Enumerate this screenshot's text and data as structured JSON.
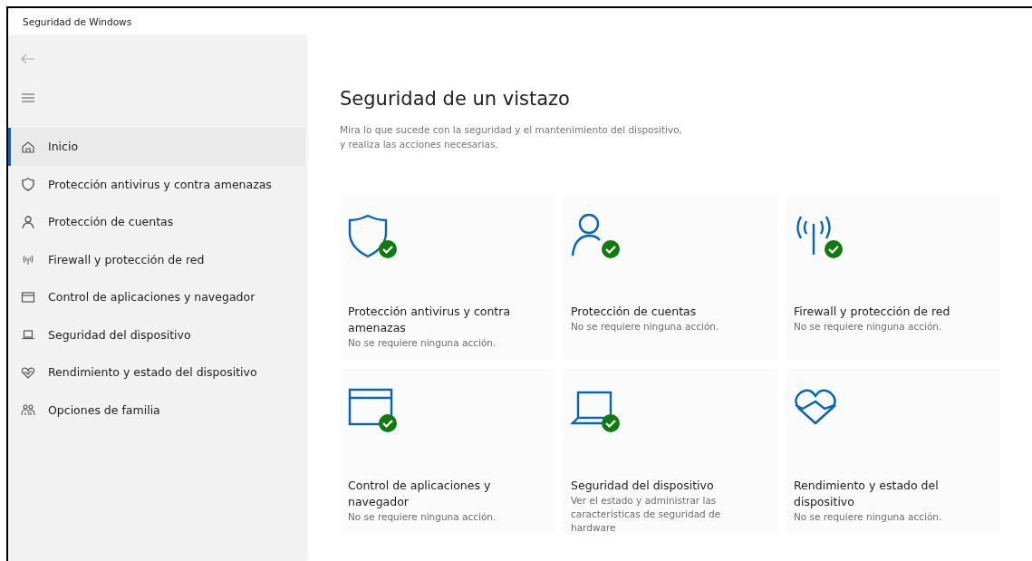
{
  "window": {
    "title": "Seguridad de Windows"
  },
  "sidebar": {
    "items": [
      {
        "label": "Inicio",
        "selected": true
      },
      {
        "label": "Protección antivirus y contra amenazas",
        "selected": false
      },
      {
        "label": "Protección de cuentas",
        "selected": false
      },
      {
        "label": "Firewall y protección de red",
        "selected": false
      },
      {
        "label": "Control de aplicaciones y navegador",
        "selected": false
      },
      {
        "label": "Seguridad del dispositivo",
        "selected": false
      },
      {
        "label": "Rendimiento y estado del dispositivo",
        "selected": false
      },
      {
        "label": "Opciones de familia",
        "selected": false
      }
    ]
  },
  "main": {
    "title": "Seguridad de un vistazo",
    "description": "Mira lo que sucede con la seguridad y el mantenimiento del dispositivo, y realiza las acciones necesarias.",
    "cards": [
      {
        "title": "Protección antivirus y contra amenazas",
        "status": "No se requiere ninguna acción.",
        "ok": true
      },
      {
        "title": "Protección de cuentas",
        "status": "No se requiere ninguna acción.",
        "ok": true
      },
      {
        "title": "Firewall y protección de red",
        "status": "No se requiere ninguna acción.",
        "ok": true
      },
      {
        "title": "Control de aplicaciones y navegador",
        "status": "No se requiere ninguna acción.",
        "ok": true
      },
      {
        "title": "Seguridad del dispositivo",
        "status": "Ver el estado y administrar las características de seguridad de hardware",
        "ok": true
      },
      {
        "title": "Rendimiento y estado del dispositivo",
        "status": "No se requiere ninguna acción.",
        "ok": false
      }
    ]
  }
}
